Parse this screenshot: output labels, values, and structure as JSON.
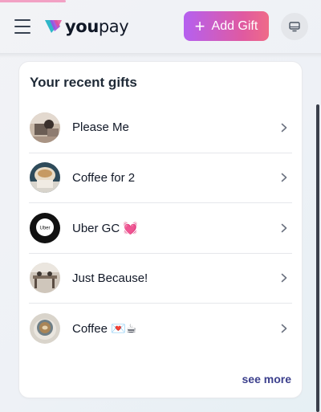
{
  "header": {
    "logo_text_bold": "you",
    "logo_text_light": "pay",
    "add_gift_label": "Add Gift",
    "accent_gradient": [
      "#b560f0",
      "#ef6b88"
    ]
  },
  "icons": {
    "menu": "hamburger-menu-icon",
    "add": "plus-icon",
    "device": "monitor-icon",
    "row_arrow": "chevron-right-icon"
  },
  "recent_gifts": {
    "title": "Your recent gifts",
    "items": [
      {
        "name": "Please Me",
        "avatar": "photo"
      },
      {
        "name": "Coffee for 2",
        "avatar": "photo"
      },
      {
        "name": "Uber GC 💓",
        "avatar": "uber-logo"
      },
      {
        "name": "Just Because!",
        "avatar": "photo"
      },
      {
        "name": "Coffee 💌☕",
        "avatar": "photo"
      }
    ],
    "see_more_label": "see more",
    "uber_badge_text": "Uber"
  }
}
